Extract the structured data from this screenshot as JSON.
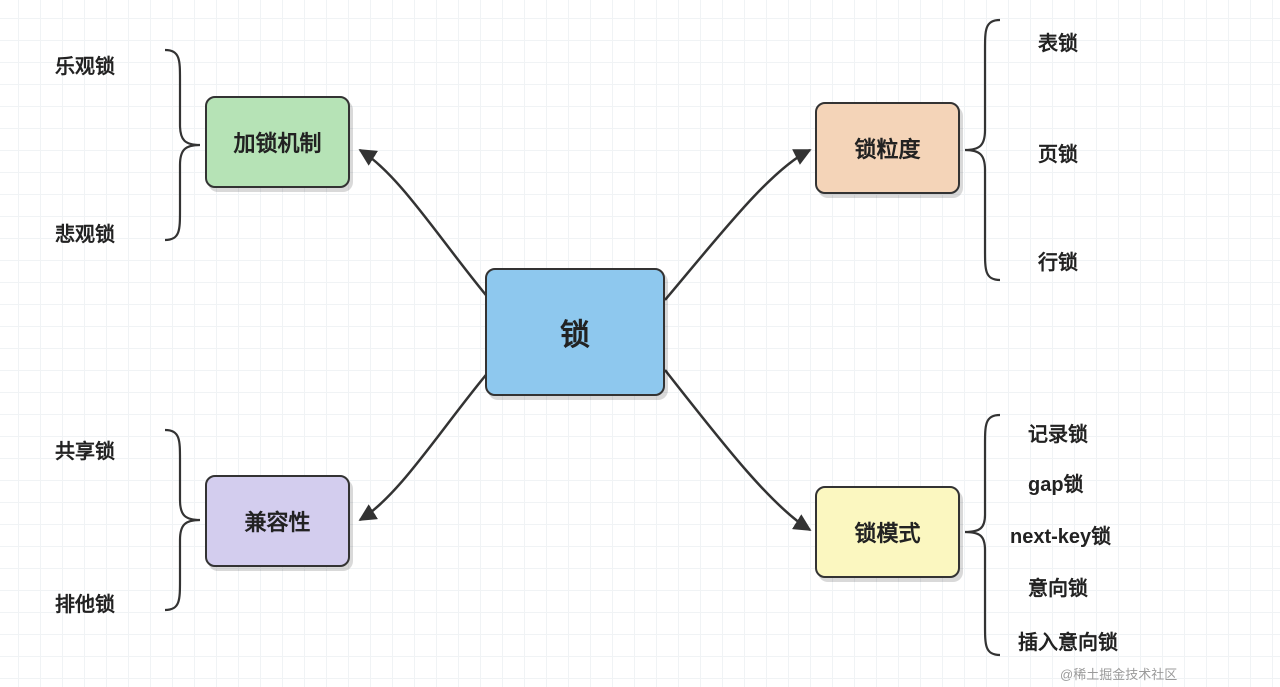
{
  "center": {
    "label": "锁"
  },
  "branches": {
    "mechanism": {
      "label": "加锁机制",
      "leaves": [
        "乐观锁",
        "悲观锁"
      ]
    },
    "compatibility": {
      "label": "兼容性",
      "leaves": [
        "共享锁",
        "排他锁"
      ]
    },
    "granularity": {
      "label": "锁粒度",
      "leaves": [
        "表锁",
        "页锁",
        "行锁"
      ]
    },
    "mode": {
      "label": "锁模式",
      "leaves": [
        "记录锁",
        "gap锁",
        "next-key锁",
        "意向锁",
        "插入意向锁"
      ]
    }
  },
  "watermark": "@稀土掘金技术社区"
}
